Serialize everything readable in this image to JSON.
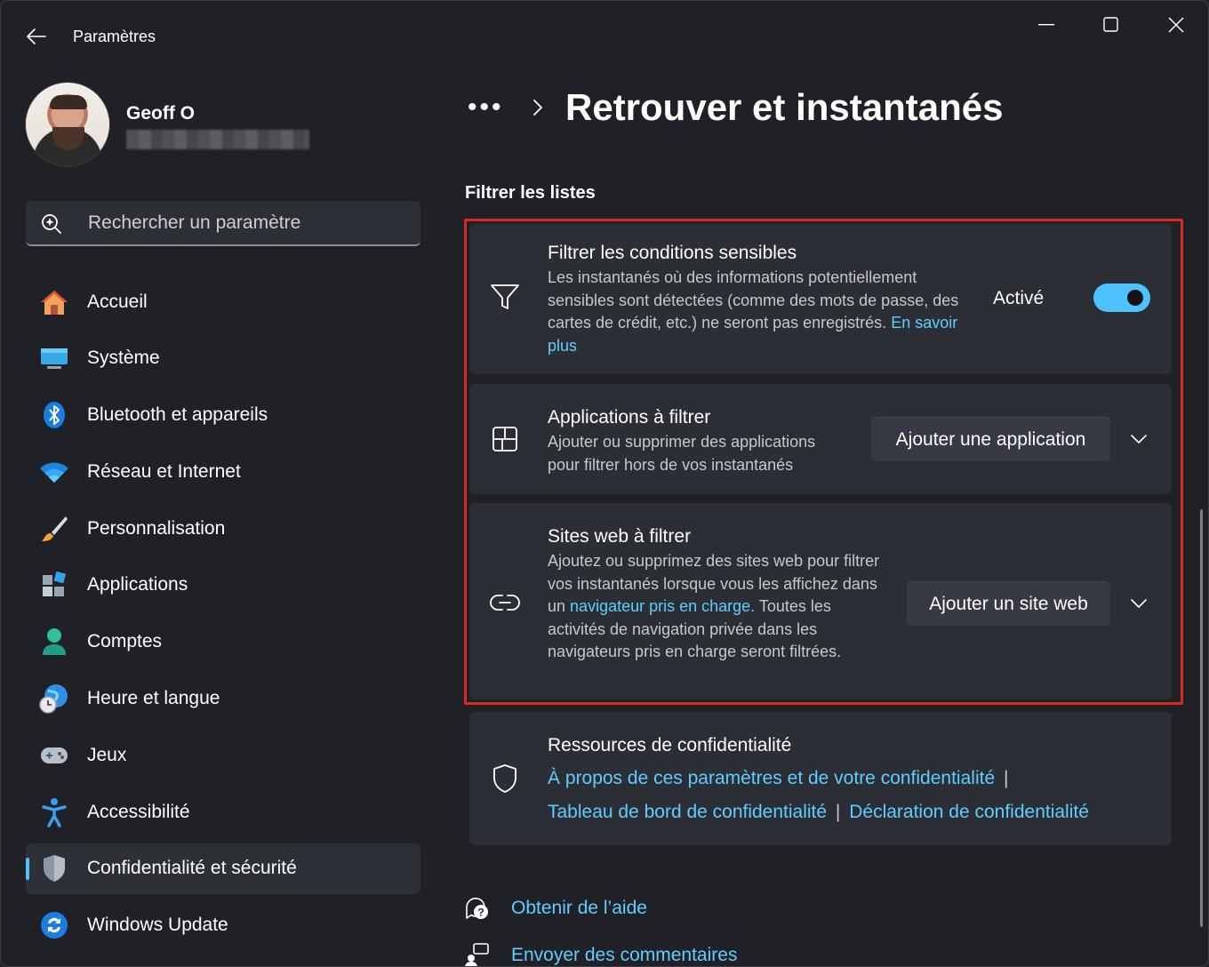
{
  "window": {
    "title": "Paramètres"
  },
  "profile": {
    "name": "Geoff O"
  },
  "search": {
    "placeholder": "Rechercher un paramètre"
  },
  "sidebar": {
    "items": [
      {
        "label": "Accueil",
        "icon": "home-icon"
      },
      {
        "label": "Système",
        "icon": "monitor-icon"
      },
      {
        "label": "Bluetooth et appareils",
        "icon": "bluetooth-icon"
      },
      {
        "label": "Réseau et Internet",
        "icon": "wifi-icon"
      },
      {
        "label": "Personnalisation",
        "icon": "brush-icon"
      },
      {
        "label": "Applications",
        "icon": "apps-icon"
      },
      {
        "label": "Comptes",
        "icon": "person-icon"
      },
      {
        "label": "Heure et langue",
        "icon": "globe-clock-icon"
      },
      {
        "label": "Jeux",
        "icon": "gamepad-icon"
      },
      {
        "label": "Accessibilité",
        "icon": "accessibility-icon"
      },
      {
        "label": "Confidentialité et sécurité",
        "icon": "shield-icon",
        "selected": true
      },
      {
        "label": "Windows Update",
        "icon": "update-icon"
      }
    ]
  },
  "breadcrumb": {
    "overflow": "•••",
    "title": "Retrouver et instantanés"
  },
  "section": {
    "title": "Filtrer les listes"
  },
  "cards": {
    "sensitive": {
      "title": "Filtrer les conditions sensibles",
      "desc": "Les instantanés où des informations potentiellement sensibles sont détectées (comme des mots de passe, des cartes de crédit, etc.) ne seront pas enregistrés.",
      "link": "En savoir plus",
      "toggle_label": "Activé",
      "toggle_on": true
    },
    "apps": {
      "title": "Applications à filtrer",
      "desc": "Ajouter ou supprimer des applications pour filtrer hors de vos instantanés",
      "button": "Ajouter une application"
    },
    "sites": {
      "title": "Sites web à filtrer",
      "desc_before": "Ajoutez ou supprimez des sites web pour filtrer vos instantanés lorsque vous les affichez dans un",
      "desc_link": "navigateur pris en charge.",
      "desc_after": "Toutes les activités de navigation privée dans les navigateurs pris en charge seront filtrées.",
      "button": "Ajouter un site web"
    },
    "privacy": {
      "title": "Ressources de confidentialité",
      "link1": "À propos de ces paramètres et de votre confidentialité",
      "link2": "Tableau de bord de confidentialité",
      "link3": "Déclaration de confidentialité",
      "separator": "|"
    }
  },
  "footer": {
    "help": "Obtenir de l’aide",
    "feedback": "Envoyer des commentaires"
  },
  "colors": {
    "accent": "#4cc2ff",
    "link": "#60cdff",
    "highlight": "#d62b1f"
  }
}
